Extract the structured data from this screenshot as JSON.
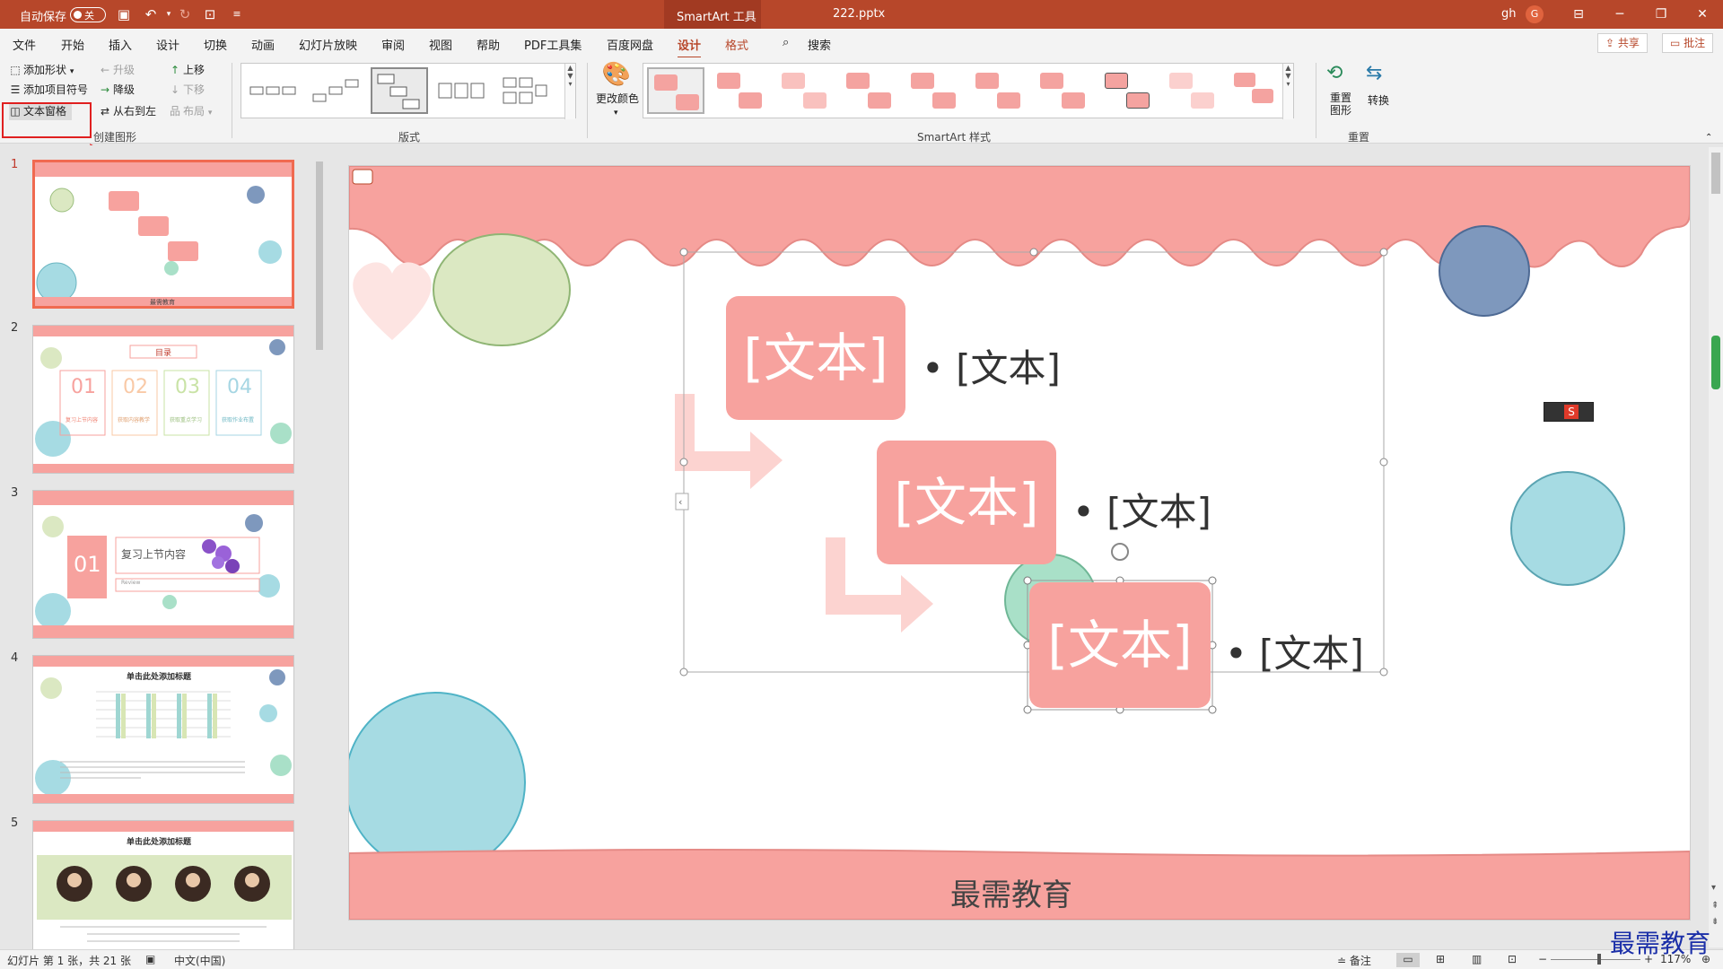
{
  "titlebar": {
    "autosave_label": "自动保存",
    "autosave_state": "关",
    "contextual_tab": "SmartArt 工具",
    "filename": "222.pptx",
    "user": "gh",
    "avatar_initial": "G"
  },
  "menu": {
    "tabs": [
      "文件",
      "开始",
      "插入",
      "设计",
      "切换",
      "动画",
      "幻灯片放映",
      "审阅",
      "视图",
      "帮助",
      "PDF工具集",
      "百度网盘"
    ],
    "context_tabs": [
      "设计",
      "格式"
    ],
    "search": "搜索",
    "share": "共享",
    "comment": "批注"
  },
  "ribbon": {
    "create": {
      "add_shape": "添加形状",
      "add_bullet": "添加项目符号",
      "text_pane": "文本窗格",
      "promote": "升级",
      "demote": "降级",
      "rtl": "从右到左",
      "move_up": "上移",
      "move_down": "下移",
      "layout": "布局",
      "group_label": "创建图形"
    },
    "layouts_label": "版式",
    "change_colors": "更改颜色",
    "styles_label": "SmartArt 样式",
    "reset_graphic": "重置图形",
    "convert": "转换",
    "reset_label": "重置"
  },
  "thumbnails": {
    "numbers": [
      "1",
      "2",
      "3",
      "4",
      "5"
    ],
    "slide1_caption": "最需教育",
    "slide2_title": "目录",
    "slide2_nums": [
      "01",
      "02",
      "03",
      "04"
    ],
    "slide2_caps": [
      "复习上节内容",
      "获取内容教学",
      "获取重点学习",
      "获取作业布置"
    ],
    "slide3_num": "01",
    "slide3_title": "复习上节内容",
    "slide3_sub": "Review",
    "slide4_title": "单击此处添加标题",
    "slide5_title": "单击此处添加标题"
  },
  "slide": {
    "box_labels": [
      "[文本]",
      "[文本]",
      "[文本]"
    ],
    "bullet_labels": [
      "• [文本]",
      "• [文本]",
      "• [文本]"
    ],
    "footer": "最需教育"
  },
  "status": {
    "slide_info": "幻灯片 第 1 张，共 21 张",
    "language": "中文(中国)",
    "notes": "备注",
    "zoom": "117%"
  },
  "watermark": "最需教育",
  "colors": {
    "accent": "#b7472a",
    "smartart_fill": "#f7a29e",
    "highlight": "#e02020"
  }
}
